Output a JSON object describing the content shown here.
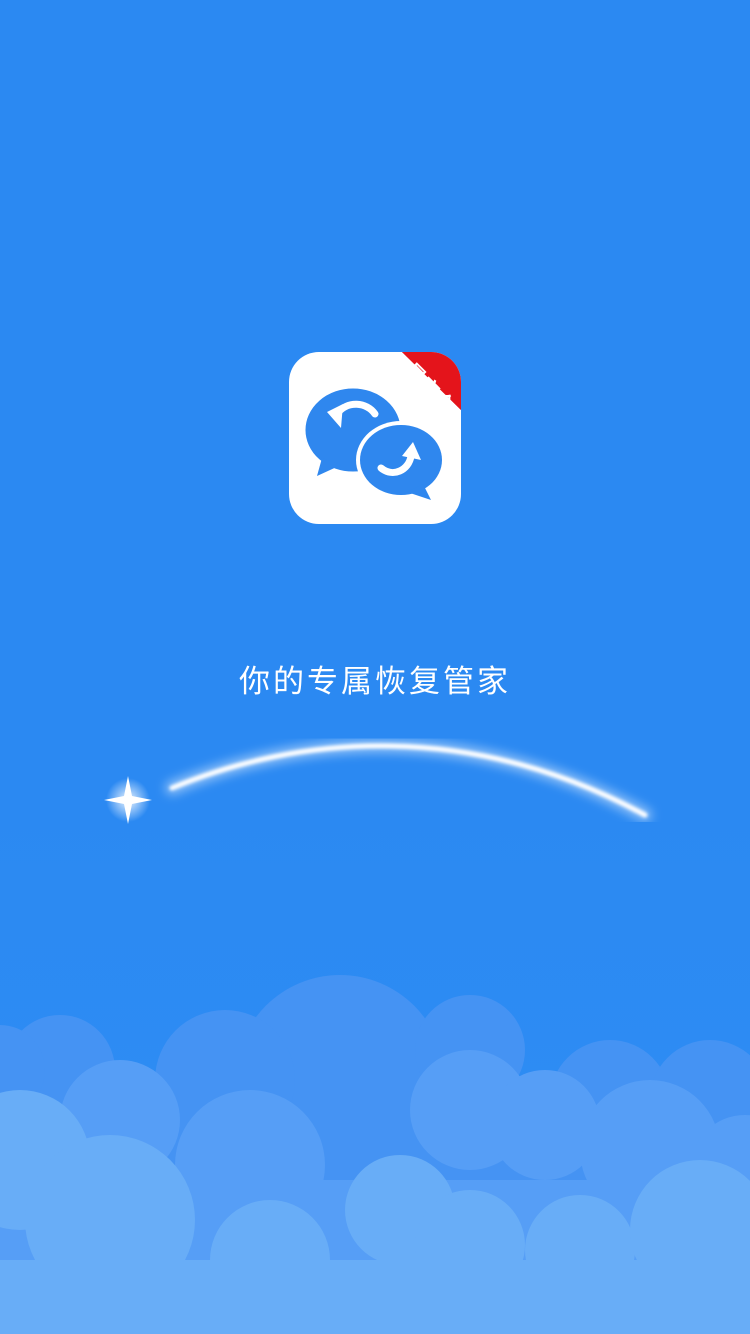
{
  "splash": {
    "badge_text": "最安全",
    "slogan": "你的专属恢复管家",
    "colors": {
      "background": "#2B89F2",
      "icon_background": "#FFFFFF",
      "bubble": "#2F87EE",
      "badge": "#E4141B"
    },
    "icons": {
      "app_icon": "chat-restore-icon",
      "sparkle": "sparkle-icon"
    }
  }
}
